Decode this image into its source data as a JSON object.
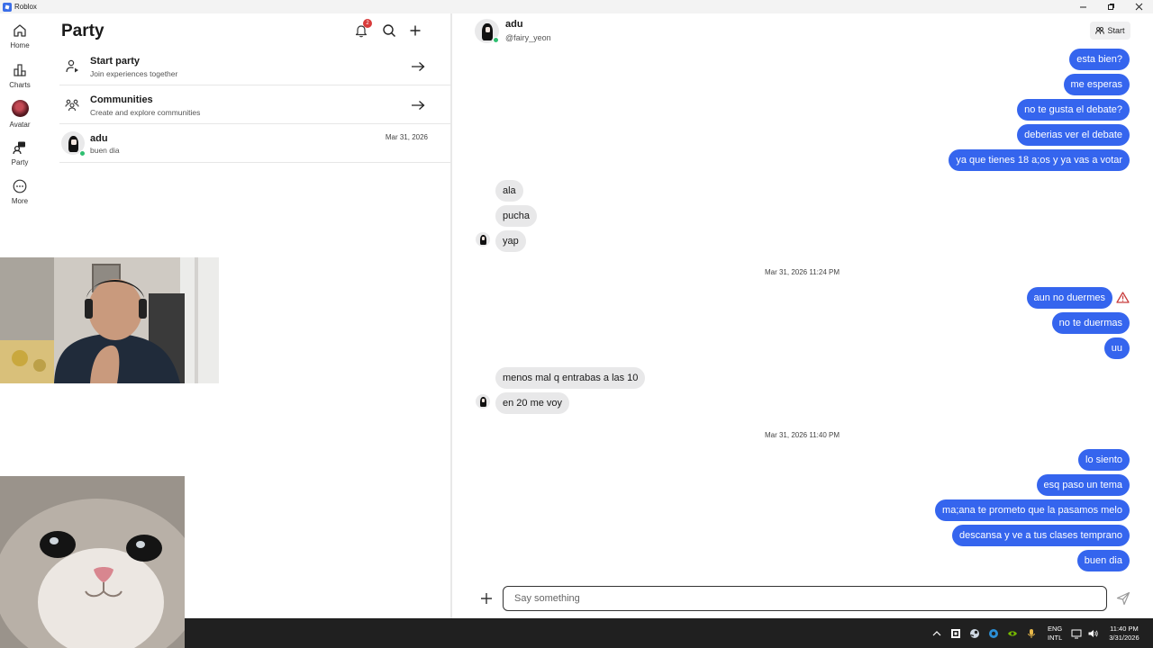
{
  "window": {
    "title": "Roblox"
  },
  "nav": {
    "items": [
      {
        "label": "Home",
        "icon": "home-icon"
      },
      {
        "label": "Charts",
        "icon": "charts-icon"
      },
      {
        "label": "Avatar",
        "icon": "avatar-icon"
      },
      {
        "label": "Party",
        "icon": "party-icon"
      },
      {
        "label": "More",
        "icon": "more-icon"
      }
    ]
  },
  "party": {
    "title": "Party",
    "notification_count": "2",
    "rows": [
      {
        "title": "Start party",
        "subtitle": "Join experiences together",
        "icon": "start-party-icon"
      },
      {
        "title": "Communities",
        "subtitle": "Create and explore communities",
        "icon": "communities-icon"
      }
    ],
    "conversation": {
      "name": "adu",
      "preview": "buen dia",
      "date": "Mar 31, 2026"
    }
  },
  "chat": {
    "name": "adu",
    "handle": "@fairy_yeon",
    "start_label": "Start",
    "messages": [
      {
        "dir": "out",
        "text": "esta bien?"
      },
      {
        "dir": "out",
        "text": "me esperas"
      },
      {
        "dir": "out",
        "text": "no te gusta el debate?"
      },
      {
        "dir": "out",
        "text": "deberias ver el debate"
      },
      {
        "dir": "out",
        "text": "ya que tienes 18 a;os y ya vas a votar"
      },
      {
        "dir": "in",
        "text": "ala"
      },
      {
        "dir": "in",
        "text": "pucha"
      },
      {
        "dir": "in",
        "text": "yap"
      },
      {
        "dir": "stamp",
        "text": "Mar 31, 2026 11:24 PM"
      },
      {
        "dir": "out",
        "text": "aun no duermes",
        "warning": true
      },
      {
        "dir": "out",
        "text": "no te duermas"
      },
      {
        "dir": "out",
        "text": "uu"
      },
      {
        "dir": "in",
        "text": "menos mal q entrabas a las 10"
      },
      {
        "dir": "in",
        "text": "en 20 me voy"
      },
      {
        "dir": "stamp",
        "text": "Mar 31, 2026 11:40 PM"
      },
      {
        "dir": "out",
        "text": "lo siento"
      },
      {
        "dir": "out",
        "text": "esq paso un tema"
      },
      {
        "dir": "out",
        "text": "ma;ana te prometo que la pasamos melo"
      },
      {
        "dir": "out",
        "text": "descansa y ve a tus clases temprano"
      },
      {
        "dir": "out",
        "text": "buen dia"
      }
    ],
    "composer": {
      "placeholder": "Say something"
    }
  },
  "taskbar": {
    "language_line1": "ENG",
    "language_line2": "INTL",
    "time": "11:40 PM",
    "date": "3/31/2026"
  },
  "colors": {
    "outgoing_bubble": "#3565ee",
    "incoming_bubble": "#e8e8e9",
    "online": "#2fbf71",
    "badge": "#d83b3b"
  }
}
